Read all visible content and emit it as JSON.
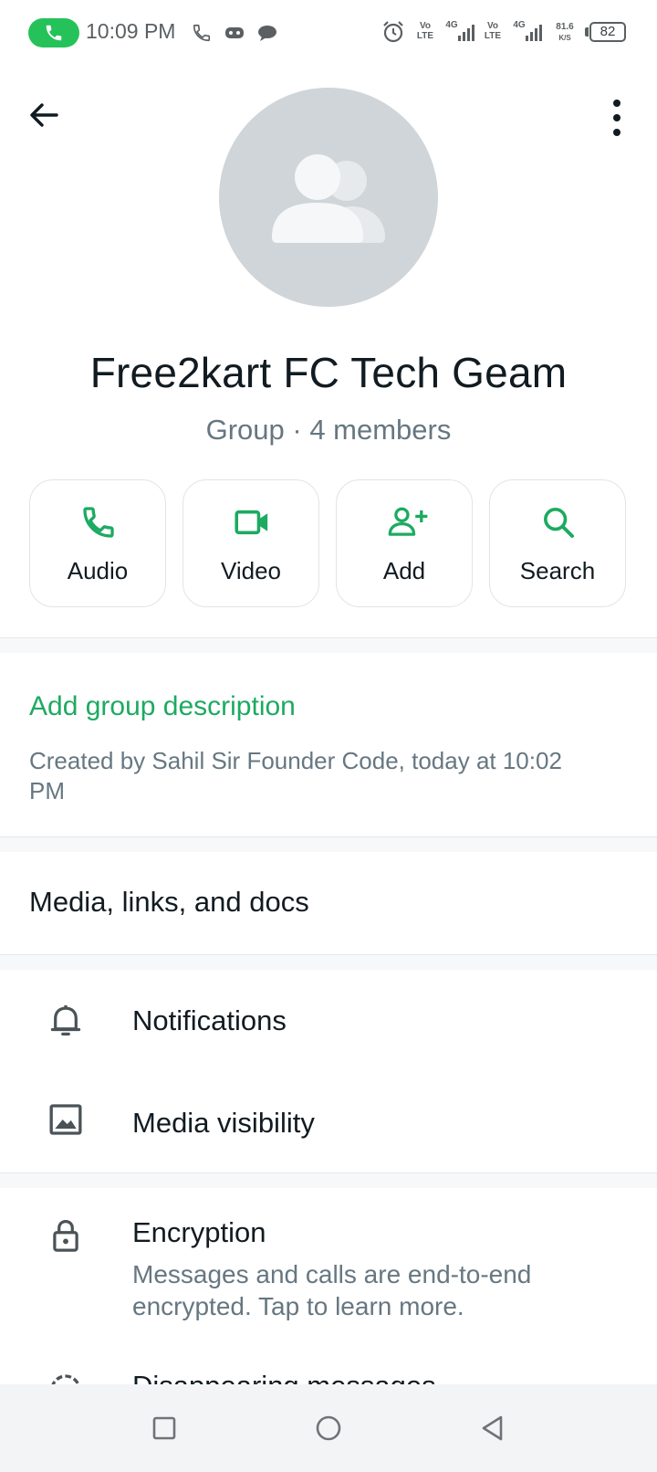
{
  "status_bar": {
    "time": "10:09 PM",
    "network_1": "Vo LTE",
    "network_gen_1": "4G",
    "network_2": "Vo LTE",
    "network_gen_2": "4G",
    "speed_value": "81.6",
    "speed_unit": "K/S",
    "battery": "82",
    "icons": [
      "phone-call-active-icon",
      "phone-icon",
      "gamepad-icon",
      "chat-bubble-icon",
      "alarm-icon",
      "signal-icon",
      "battery-icon"
    ]
  },
  "header": {
    "group_name": "Free2kart FC Tech Geam",
    "subtitle": "Group · 4 members"
  },
  "actions": [
    {
      "label": "Audio",
      "icon": "phone-icon"
    },
    {
      "label": "Video",
      "icon": "video-camera-icon"
    },
    {
      "label": "Add",
      "icon": "add-person-icon"
    },
    {
      "label": "Search",
      "icon": "search-icon"
    }
  ],
  "description": {
    "link": "Add group description",
    "created": "Created by Sahil Sir Founder Code, today at 10:02 PM"
  },
  "media": {
    "label": "Media, links, and docs"
  },
  "settings": {
    "notifications": "Notifications",
    "media_visibility": "Media visibility",
    "encryption": "Encryption",
    "encryption_sub": "Messages and calls are end-to-end encrypted. Tap to learn more.",
    "disappearing": "Disappearing messages"
  },
  "colors": {
    "accent": "#1daa61",
    "call_pill": "#25c25a",
    "secondary_text": "#667781"
  }
}
